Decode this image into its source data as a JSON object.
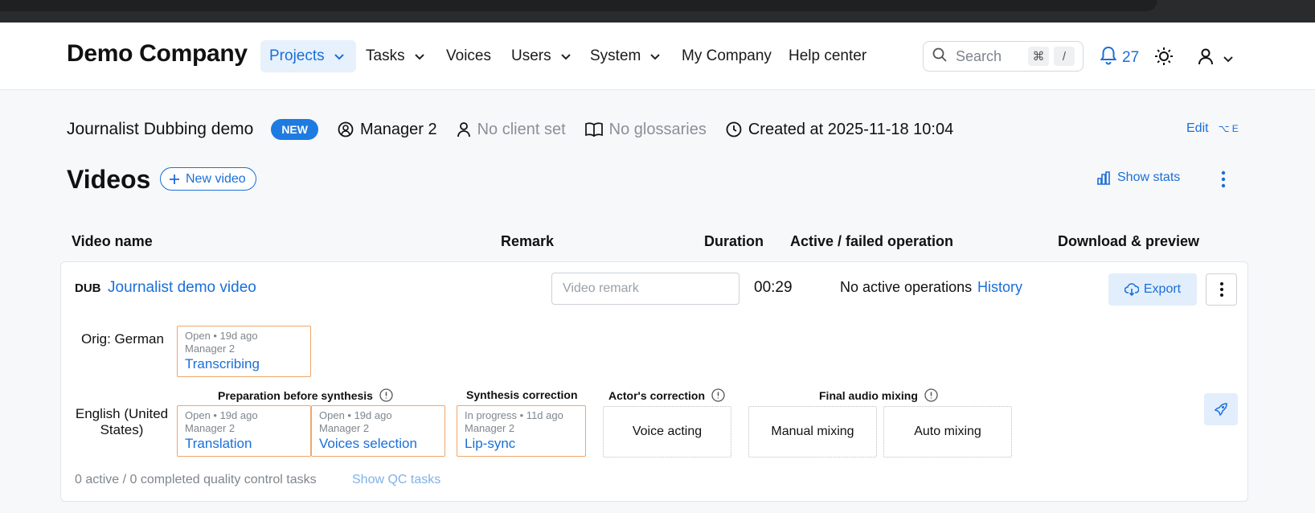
{
  "header": {
    "brand": "Demo Company",
    "nav": [
      {
        "label": "Projects",
        "active": true,
        "dropdown": true
      },
      {
        "label": "Tasks",
        "dropdown": true
      },
      {
        "label": "Voices",
        "dropdown": false
      },
      {
        "label": "Users",
        "dropdown": true
      },
      {
        "label": "System",
        "dropdown": true
      },
      {
        "label": "My Company",
        "dropdown": false
      },
      {
        "label": "Help center",
        "dropdown": false
      }
    ],
    "search": {
      "placeholder": "Search",
      "shortcut_mod": "⌘",
      "shortcut_key": "/"
    },
    "notifications_count": "27"
  },
  "project": {
    "name": "Journalist Dubbing demo",
    "badge": "NEW",
    "manager": "Manager 2",
    "client": "No client set",
    "glossaries": "No glossaries",
    "created": "Created at 2025-11-18 10:04",
    "edit_label": "Edit",
    "edit_shortcut": "⌥ E"
  },
  "videos": {
    "title": "Videos",
    "new_video_label": "New video",
    "show_stats_label": "Show stats",
    "columns": [
      "Video name",
      "Remark",
      "Duration",
      "Active / failed operation",
      "Download & preview"
    ]
  },
  "row": {
    "type_tag": "DUB",
    "video_name": "Journalist demo video",
    "remark_placeholder": "Video remark",
    "duration": "00:29",
    "operations": "No active operations",
    "history_label": "History",
    "export_label": "Export",
    "orig_lang": "Orig: German",
    "orig_task": {
      "status": "Open • 19d ago",
      "manager": "Manager 2",
      "name": "Transcribing"
    },
    "target_lang": "English (United States)",
    "stages": {
      "prep": "Preparation before synthesis",
      "synth": "Synthesis correction",
      "actor": "Actor's correction",
      "final": "Final audio mixing"
    },
    "tasks": [
      {
        "status": "Open • 19d ago",
        "manager": "Manager 2",
        "name": "Translation"
      },
      {
        "status": "Open • 19d ago",
        "manager": "Manager 2",
        "name": "Voices selection"
      },
      {
        "status": "In progress • 11d ago",
        "manager": "Manager 2",
        "name": "Lip-sync"
      }
    ],
    "pending": {
      "voice_acting": "Voice acting",
      "manual_mixing": "Manual mixing",
      "auto_mixing": "Auto mixing"
    },
    "qc_summary": "0 active / 0 completed quality control tasks",
    "show_qc_label": "Show QC tasks"
  },
  "colors": {
    "accent": "#1a6fd8",
    "task_border": "#f0a66a",
    "badge": "#1e7be0"
  }
}
